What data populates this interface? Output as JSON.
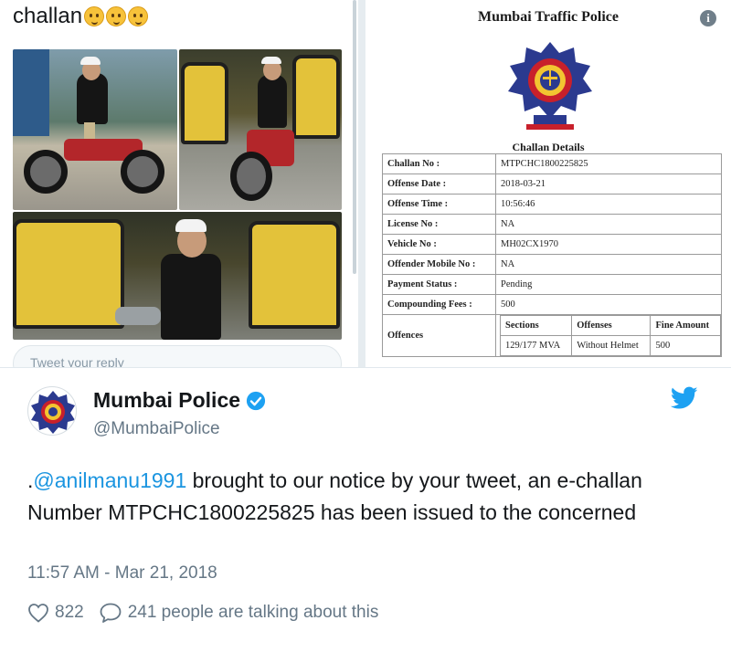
{
  "left_card": {
    "caption": "challan",
    "emoji": [
      "face-with-hand-over-mouth-emoji",
      "face-with-hand-over-mouth-emoji",
      "face-with-hand-over-mouth-emoji"
    ],
    "reply_placeholder": "Tweet your reply"
  },
  "challan": {
    "title": "Mumbai Traffic Police",
    "subtitle": "Challan Details",
    "rows": [
      {
        "label": "Challan No :",
        "value": "MTPCHC1800225825"
      },
      {
        "label": "Offense Date :",
        "value": "2018-03-21"
      },
      {
        "label": "Offense Time :",
        "value": "10:56:46"
      },
      {
        "label": "License No :",
        "value": "NA"
      },
      {
        "label": "Vehicle No :",
        "value": "MH02CX1970"
      },
      {
        "label": "Offender Mobile No :",
        "value": "NA"
      },
      {
        "label": "Payment Status :",
        "value": "Pending"
      },
      {
        "label": "Compounding Fees :",
        "value": "500"
      }
    ],
    "offences": {
      "label": "Offences",
      "headers": [
        "Sections",
        "Offenses",
        "Fine Amount"
      ],
      "row": [
        "129/177 MVA",
        "Without Helmet",
        "500"
      ]
    }
  },
  "tweet": {
    "author": "Mumbai Police",
    "handle": "@MumbaiPolice",
    "text_prefix": ".",
    "mention": "@anilmanu1991",
    "text": " brought to our notice by your tweet, an e-challan Number MTPCHC1800225825 has been issued to the concerned",
    "timestamp": "11:57 AM - Mar 21, 2018",
    "likes": "822",
    "talking": "241 people are talking about this"
  },
  "colors": {
    "accent": "#1da1f2",
    "mention": "#1b95e0",
    "muted": "#657786",
    "police_blue": "#2b3a8f",
    "police_red": "#c8202b"
  }
}
